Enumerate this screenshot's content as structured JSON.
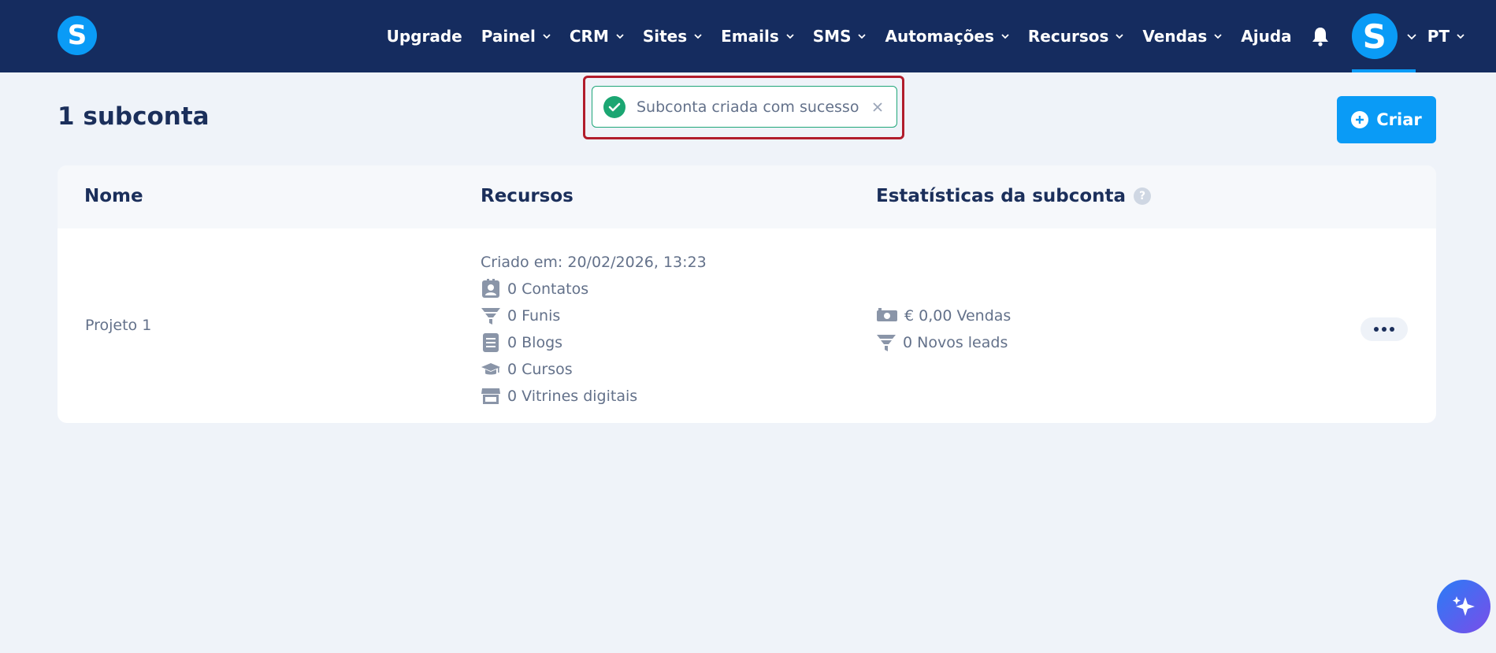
{
  "header": {
    "logo_letter": "S",
    "nav": [
      {
        "label": "Upgrade",
        "dropdown": false
      },
      {
        "label": "Painel",
        "dropdown": true
      },
      {
        "label": "CRM",
        "dropdown": true
      },
      {
        "label": "Sites",
        "dropdown": true
      },
      {
        "label": "Emails",
        "dropdown": true
      },
      {
        "label": "SMS",
        "dropdown": true
      },
      {
        "label": "Automações",
        "dropdown": true
      },
      {
        "label": "Recursos",
        "dropdown": true
      },
      {
        "label": "Vendas",
        "dropdown": true
      },
      {
        "label": "Ajuda",
        "dropdown": false
      }
    ],
    "avatar_letter": "S",
    "language": "PT"
  },
  "page": {
    "title": "1 subconta",
    "create_label": "Criar"
  },
  "toast": {
    "message": "Subconta criada com sucesso"
  },
  "table": {
    "headers": {
      "name": "Nome",
      "resources": "Recursos",
      "stats": "Estatísticas da subconta",
      "stats_help": "?"
    },
    "rows": [
      {
        "name": "Projeto 1",
        "created": "Criado em: 20/02/2026, 13:23",
        "resources": [
          {
            "icon": "contacts-icon",
            "text": "0 Contatos"
          },
          {
            "icon": "funnel-icon",
            "text": "0 Funis"
          },
          {
            "icon": "blog-icon",
            "text": "0 Blogs"
          },
          {
            "icon": "graduation-cap-icon",
            "text": "0 Cursos"
          },
          {
            "icon": "storefront-icon",
            "text": "0 Vitrines digitais"
          }
        ],
        "stats": [
          {
            "icon": "money-icon",
            "text": "€ 0,00 Vendas"
          },
          {
            "icon": "funnel-icon",
            "text": "0 Novos leads"
          }
        ]
      }
    ]
  },
  "colors": {
    "nav_bg": "#152c5f",
    "brand_blue": "#0a9bf6",
    "toast_green": "#1ba672",
    "highlight_red": "#b11d2c",
    "page_bg": "#eff3f9"
  }
}
